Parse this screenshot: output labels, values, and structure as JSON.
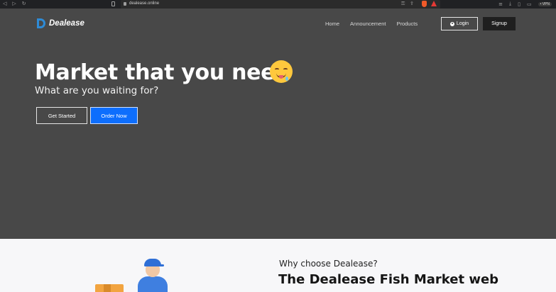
{
  "browser": {
    "url": "dealease.online",
    "vpn_label": "• VPN"
  },
  "header": {
    "logo_text": "Dealease",
    "nav": [
      "Home",
      "Announcement",
      "Products"
    ],
    "login_label": "Login",
    "signup_label": "Signup"
  },
  "hero": {
    "headline": "Market that you need",
    "subheadline": "What are you waiting for?",
    "get_started_label": "Get Started",
    "order_now_label": "Order Now"
  },
  "about": {
    "eyebrow": "Why choose Dealease?",
    "title": "The Dealease Fish Market web"
  },
  "colors": {
    "hero_bg": "#484848",
    "accent_blue": "#0d6efd",
    "signup_bg": "#1f1f1f"
  }
}
